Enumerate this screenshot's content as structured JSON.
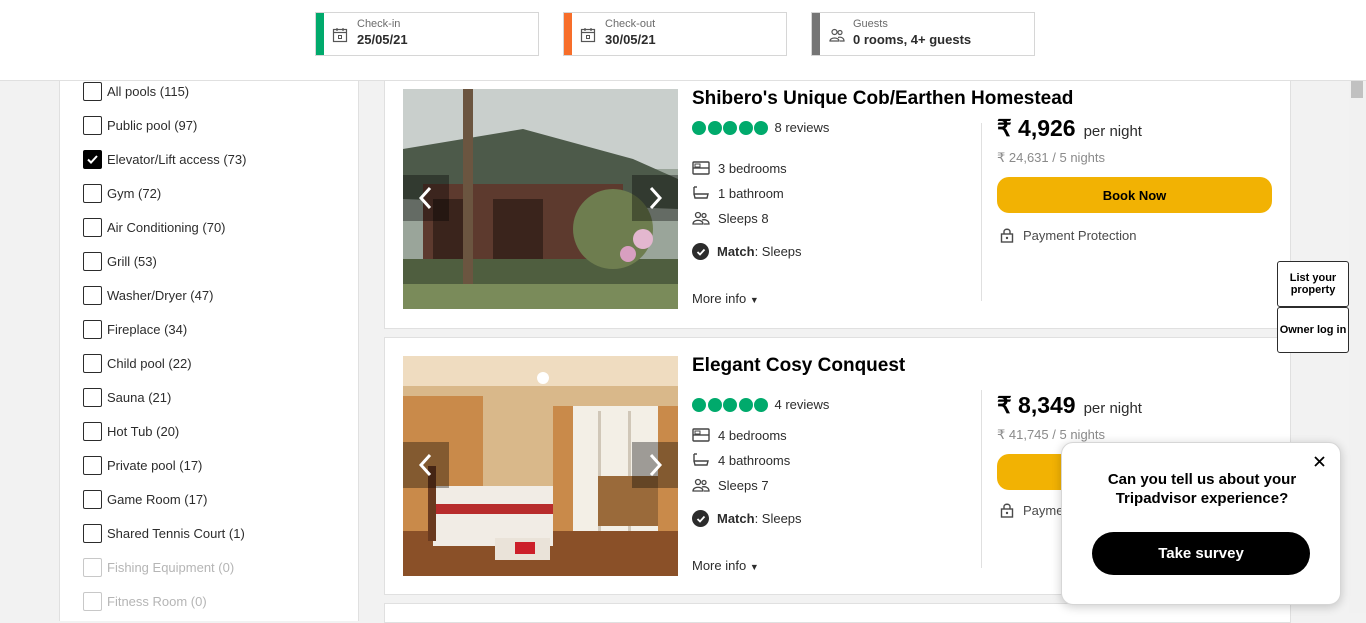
{
  "search_bar": {
    "checkin": {
      "label": "Check-in",
      "value": "25/05/21",
      "accent": "#00aa6c"
    },
    "checkout": {
      "label": "Check-out",
      "value": "30/05/21",
      "accent": "#f76e2a"
    },
    "guests": {
      "label": "Guests",
      "value": "0 rooms, 4+ guests",
      "accent": "#757575"
    }
  },
  "filters": [
    {
      "label": "All pools (115)",
      "checked": false,
      "disabled": false
    },
    {
      "label": "Public pool (97)",
      "checked": false,
      "disabled": false
    },
    {
      "label": "Elevator/Lift access (73)",
      "checked": true,
      "disabled": false
    },
    {
      "label": "Gym (72)",
      "checked": false,
      "disabled": false
    },
    {
      "label": "Air Conditioning (70)",
      "checked": false,
      "disabled": false
    },
    {
      "label": "Grill (53)",
      "checked": false,
      "disabled": false
    },
    {
      "label": "Washer/Dryer (47)",
      "checked": false,
      "disabled": false
    },
    {
      "label": "Fireplace (34)",
      "checked": false,
      "disabled": false
    },
    {
      "label": "Child pool (22)",
      "checked": false,
      "disabled": false
    },
    {
      "label": "Sauna (21)",
      "checked": false,
      "disabled": false
    },
    {
      "label": "Hot Tub (20)",
      "checked": false,
      "disabled": false
    },
    {
      "label": "Private pool (17)",
      "checked": false,
      "disabled": false
    },
    {
      "label": "Game Room (17)",
      "checked": false,
      "disabled": false
    },
    {
      "label": "Shared Tennis Court (1)",
      "checked": false,
      "disabled": false
    },
    {
      "label": "Fishing Equipment (0)",
      "checked": false,
      "disabled": true
    },
    {
      "label": "Fitness Room (0)",
      "checked": false,
      "disabled": true
    }
  ],
  "listings": [
    {
      "title": "Shibero's Unique Cob/Earthen Homestead",
      "reviews": "8 reviews",
      "bedrooms": "3 bedrooms",
      "bathrooms": "1 bathroom",
      "sleeps": "Sleeps 8",
      "match_label": "Match",
      "match_value": ": Sleeps",
      "more_info": "More info",
      "price": "₹ 4,926",
      "per_night": "per night",
      "total": "₹ 24,631 / 5 nights",
      "book_label": "Book Now",
      "protection": "Payment Protection"
    },
    {
      "title": "Elegant Cosy Conquest",
      "reviews": "4 reviews",
      "bedrooms": "4 bedrooms",
      "bathrooms": "4 bathrooms",
      "sleeps": "Sleeps 7",
      "match_label": "Match",
      "match_value": ": Sleeps",
      "more_info": "More info",
      "price": "₹ 8,349",
      "per_night": "per night",
      "total": "₹ 41,745 / 5 nights",
      "protection": "Payme"
    }
  ],
  "owner_links": {
    "list_property": "List your property",
    "owner_login": "Owner log in"
  },
  "survey": {
    "question": "Can you tell us about your Tripadvisor experience?",
    "button": "Take survey"
  },
  "colors": {
    "rating": "#00aa6c",
    "book_button": "#f2b203"
  }
}
